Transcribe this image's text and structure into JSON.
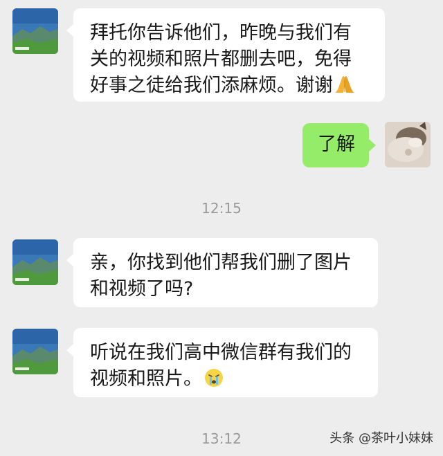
{
  "messages": [
    {
      "direction": "incoming",
      "lines": [
        "拜托你告诉他们，昨晚与我们有",
        "关的视频和照片都删去吧，免得",
        "好事之徒给我们添麻烦。谢谢"
      ],
      "emoji": "praying-hands"
    },
    {
      "direction": "outgoing",
      "lines": [
        "了解"
      ]
    },
    {
      "direction": "incoming",
      "lines": [
        "亲，你找到他们帮我们删了图片",
        "和视频了吗?"
      ]
    },
    {
      "direction": "incoming",
      "lines": [
        "听说在我们高中微信群有我们的",
        "视频和照片。"
      ],
      "emoji": "crying-face"
    }
  ],
  "timestamps": [
    "12:15",
    "13:12"
  ],
  "watermark": "头条 @茶叶小妹妹",
  "colors": {
    "background": "#ededed",
    "incoming_bubble": "#ffffff",
    "outgoing_bubble": "#95ec69",
    "timestamp": "#9a9a9a"
  }
}
